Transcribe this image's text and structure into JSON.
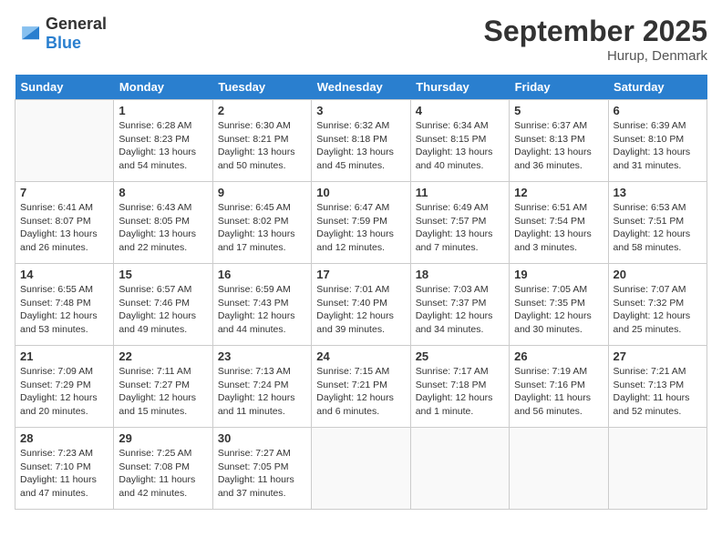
{
  "header": {
    "logo_general": "General",
    "logo_blue": "Blue",
    "title": "September 2025",
    "location": "Hurup, Denmark"
  },
  "days_of_week": [
    "Sunday",
    "Monday",
    "Tuesday",
    "Wednesday",
    "Thursday",
    "Friday",
    "Saturday"
  ],
  "weeks": [
    [
      {
        "day": "",
        "info": ""
      },
      {
        "day": "1",
        "info": "Sunrise: 6:28 AM\nSunset: 8:23 PM\nDaylight: 13 hours\nand 54 minutes."
      },
      {
        "day": "2",
        "info": "Sunrise: 6:30 AM\nSunset: 8:21 PM\nDaylight: 13 hours\nand 50 minutes."
      },
      {
        "day": "3",
        "info": "Sunrise: 6:32 AM\nSunset: 8:18 PM\nDaylight: 13 hours\nand 45 minutes."
      },
      {
        "day": "4",
        "info": "Sunrise: 6:34 AM\nSunset: 8:15 PM\nDaylight: 13 hours\nand 40 minutes."
      },
      {
        "day": "5",
        "info": "Sunrise: 6:37 AM\nSunset: 8:13 PM\nDaylight: 13 hours\nand 36 minutes."
      },
      {
        "day": "6",
        "info": "Sunrise: 6:39 AM\nSunset: 8:10 PM\nDaylight: 13 hours\nand 31 minutes."
      }
    ],
    [
      {
        "day": "7",
        "info": "Sunrise: 6:41 AM\nSunset: 8:07 PM\nDaylight: 13 hours\nand 26 minutes."
      },
      {
        "day": "8",
        "info": "Sunrise: 6:43 AM\nSunset: 8:05 PM\nDaylight: 13 hours\nand 22 minutes."
      },
      {
        "day": "9",
        "info": "Sunrise: 6:45 AM\nSunset: 8:02 PM\nDaylight: 13 hours\nand 17 minutes."
      },
      {
        "day": "10",
        "info": "Sunrise: 6:47 AM\nSunset: 7:59 PM\nDaylight: 13 hours\nand 12 minutes."
      },
      {
        "day": "11",
        "info": "Sunrise: 6:49 AM\nSunset: 7:57 PM\nDaylight: 13 hours\nand 7 minutes."
      },
      {
        "day": "12",
        "info": "Sunrise: 6:51 AM\nSunset: 7:54 PM\nDaylight: 13 hours\nand 3 minutes."
      },
      {
        "day": "13",
        "info": "Sunrise: 6:53 AM\nSunset: 7:51 PM\nDaylight: 12 hours\nand 58 minutes."
      }
    ],
    [
      {
        "day": "14",
        "info": "Sunrise: 6:55 AM\nSunset: 7:48 PM\nDaylight: 12 hours\nand 53 minutes."
      },
      {
        "day": "15",
        "info": "Sunrise: 6:57 AM\nSunset: 7:46 PM\nDaylight: 12 hours\nand 49 minutes."
      },
      {
        "day": "16",
        "info": "Sunrise: 6:59 AM\nSunset: 7:43 PM\nDaylight: 12 hours\nand 44 minutes."
      },
      {
        "day": "17",
        "info": "Sunrise: 7:01 AM\nSunset: 7:40 PM\nDaylight: 12 hours\nand 39 minutes."
      },
      {
        "day": "18",
        "info": "Sunrise: 7:03 AM\nSunset: 7:37 PM\nDaylight: 12 hours\nand 34 minutes."
      },
      {
        "day": "19",
        "info": "Sunrise: 7:05 AM\nSunset: 7:35 PM\nDaylight: 12 hours\nand 30 minutes."
      },
      {
        "day": "20",
        "info": "Sunrise: 7:07 AM\nSunset: 7:32 PM\nDaylight: 12 hours\nand 25 minutes."
      }
    ],
    [
      {
        "day": "21",
        "info": "Sunrise: 7:09 AM\nSunset: 7:29 PM\nDaylight: 12 hours\nand 20 minutes."
      },
      {
        "day": "22",
        "info": "Sunrise: 7:11 AM\nSunset: 7:27 PM\nDaylight: 12 hours\nand 15 minutes."
      },
      {
        "day": "23",
        "info": "Sunrise: 7:13 AM\nSunset: 7:24 PM\nDaylight: 12 hours\nand 11 minutes."
      },
      {
        "day": "24",
        "info": "Sunrise: 7:15 AM\nSunset: 7:21 PM\nDaylight: 12 hours\nand 6 minutes."
      },
      {
        "day": "25",
        "info": "Sunrise: 7:17 AM\nSunset: 7:18 PM\nDaylight: 12 hours\nand 1 minute."
      },
      {
        "day": "26",
        "info": "Sunrise: 7:19 AM\nSunset: 7:16 PM\nDaylight: 11 hours\nand 56 minutes."
      },
      {
        "day": "27",
        "info": "Sunrise: 7:21 AM\nSunset: 7:13 PM\nDaylight: 11 hours\nand 52 minutes."
      }
    ],
    [
      {
        "day": "28",
        "info": "Sunrise: 7:23 AM\nSunset: 7:10 PM\nDaylight: 11 hours\nand 47 minutes."
      },
      {
        "day": "29",
        "info": "Sunrise: 7:25 AM\nSunset: 7:08 PM\nDaylight: 11 hours\nand 42 minutes."
      },
      {
        "day": "30",
        "info": "Sunrise: 7:27 AM\nSunset: 7:05 PM\nDaylight: 11 hours\nand 37 minutes."
      },
      {
        "day": "",
        "info": ""
      },
      {
        "day": "",
        "info": ""
      },
      {
        "day": "",
        "info": ""
      },
      {
        "day": "",
        "info": ""
      }
    ]
  ]
}
